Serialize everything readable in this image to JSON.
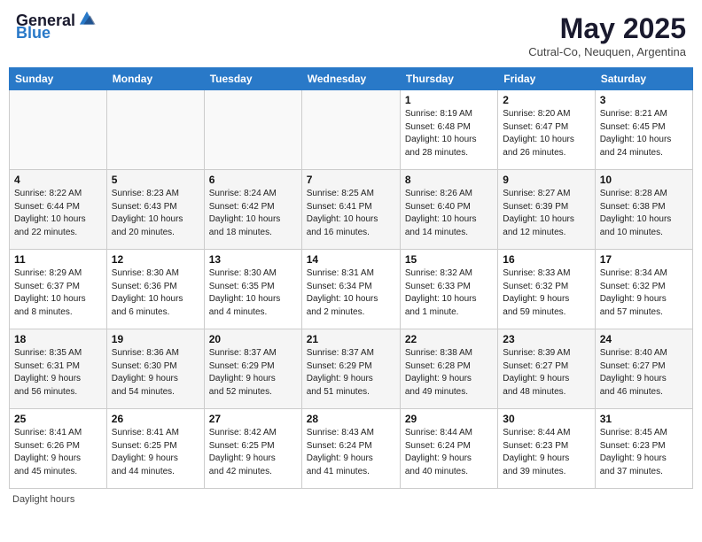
{
  "header": {
    "logo_general": "General",
    "logo_blue": "Blue",
    "month_year": "May 2025",
    "location": "Cutral-Co, Neuquen, Argentina"
  },
  "days_of_week": [
    "Sunday",
    "Monday",
    "Tuesday",
    "Wednesday",
    "Thursday",
    "Friday",
    "Saturday"
  ],
  "weeks": [
    [
      {
        "day": "",
        "info": ""
      },
      {
        "day": "",
        "info": ""
      },
      {
        "day": "",
        "info": ""
      },
      {
        "day": "",
        "info": ""
      },
      {
        "day": "1",
        "info": "Sunrise: 8:19 AM\nSunset: 6:48 PM\nDaylight: 10 hours\nand 28 minutes."
      },
      {
        "day": "2",
        "info": "Sunrise: 8:20 AM\nSunset: 6:47 PM\nDaylight: 10 hours\nand 26 minutes."
      },
      {
        "day": "3",
        "info": "Sunrise: 8:21 AM\nSunset: 6:45 PM\nDaylight: 10 hours\nand 24 minutes."
      }
    ],
    [
      {
        "day": "4",
        "info": "Sunrise: 8:22 AM\nSunset: 6:44 PM\nDaylight: 10 hours\nand 22 minutes."
      },
      {
        "day": "5",
        "info": "Sunrise: 8:23 AM\nSunset: 6:43 PM\nDaylight: 10 hours\nand 20 minutes."
      },
      {
        "day": "6",
        "info": "Sunrise: 8:24 AM\nSunset: 6:42 PM\nDaylight: 10 hours\nand 18 minutes."
      },
      {
        "day": "7",
        "info": "Sunrise: 8:25 AM\nSunset: 6:41 PM\nDaylight: 10 hours\nand 16 minutes."
      },
      {
        "day": "8",
        "info": "Sunrise: 8:26 AM\nSunset: 6:40 PM\nDaylight: 10 hours\nand 14 minutes."
      },
      {
        "day": "9",
        "info": "Sunrise: 8:27 AM\nSunset: 6:39 PM\nDaylight: 10 hours\nand 12 minutes."
      },
      {
        "day": "10",
        "info": "Sunrise: 8:28 AM\nSunset: 6:38 PM\nDaylight: 10 hours\nand 10 minutes."
      }
    ],
    [
      {
        "day": "11",
        "info": "Sunrise: 8:29 AM\nSunset: 6:37 PM\nDaylight: 10 hours\nand 8 minutes."
      },
      {
        "day": "12",
        "info": "Sunrise: 8:30 AM\nSunset: 6:36 PM\nDaylight: 10 hours\nand 6 minutes."
      },
      {
        "day": "13",
        "info": "Sunrise: 8:30 AM\nSunset: 6:35 PM\nDaylight: 10 hours\nand 4 minutes."
      },
      {
        "day": "14",
        "info": "Sunrise: 8:31 AM\nSunset: 6:34 PM\nDaylight: 10 hours\nand 2 minutes."
      },
      {
        "day": "15",
        "info": "Sunrise: 8:32 AM\nSunset: 6:33 PM\nDaylight: 10 hours\nand 1 minute."
      },
      {
        "day": "16",
        "info": "Sunrise: 8:33 AM\nSunset: 6:32 PM\nDaylight: 9 hours\nand 59 minutes."
      },
      {
        "day": "17",
        "info": "Sunrise: 8:34 AM\nSunset: 6:32 PM\nDaylight: 9 hours\nand 57 minutes."
      }
    ],
    [
      {
        "day": "18",
        "info": "Sunrise: 8:35 AM\nSunset: 6:31 PM\nDaylight: 9 hours\nand 56 minutes."
      },
      {
        "day": "19",
        "info": "Sunrise: 8:36 AM\nSunset: 6:30 PM\nDaylight: 9 hours\nand 54 minutes."
      },
      {
        "day": "20",
        "info": "Sunrise: 8:37 AM\nSunset: 6:29 PM\nDaylight: 9 hours\nand 52 minutes."
      },
      {
        "day": "21",
        "info": "Sunrise: 8:37 AM\nSunset: 6:29 PM\nDaylight: 9 hours\nand 51 minutes."
      },
      {
        "day": "22",
        "info": "Sunrise: 8:38 AM\nSunset: 6:28 PM\nDaylight: 9 hours\nand 49 minutes."
      },
      {
        "day": "23",
        "info": "Sunrise: 8:39 AM\nSunset: 6:27 PM\nDaylight: 9 hours\nand 48 minutes."
      },
      {
        "day": "24",
        "info": "Sunrise: 8:40 AM\nSunset: 6:27 PM\nDaylight: 9 hours\nand 46 minutes."
      }
    ],
    [
      {
        "day": "25",
        "info": "Sunrise: 8:41 AM\nSunset: 6:26 PM\nDaylight: 9 hours\nand 45 minutes."
      },
      {
        "day": "26",
        "info": "Sunrise: 8:41 AM\nSunset: 6:25 PM\nDaylight: 9 hours\nand 44 minutes."
      },
      {
        "day": "27",
        "info": "Sunrise: 8:42 AM\nSunset: 6:25 PM\nDaylight: 9 hours\nand 42 minutes."
      },
      {
        "day": "28",
        "info": "Sunrise: 8:43 AM\nSunset: 6:24 PM\nDaylight: 9 hours\nand 41 minutes."
      },
      {
        "day": "29",
        "info": "Sunrise: 8:44 AM\nSunset: 6:24 PM\nDaylight: 9 hours\nand 40 minutes."
      },
      {
        "day": "30",
        "info": "Sunrise: 8:44 AM\nSunset: 6:23 PM\nDaylight: 9 hours\nand 39 minutes."
      },
      {
        "day": "31",
        "info": "Sunrise: 8:45 AM\nSunset: 6:23 PM\nDaylight: 9 hours\nand 37 minutes."
      }
    ]
  ],
  "footer": "Daylight hours"
}
